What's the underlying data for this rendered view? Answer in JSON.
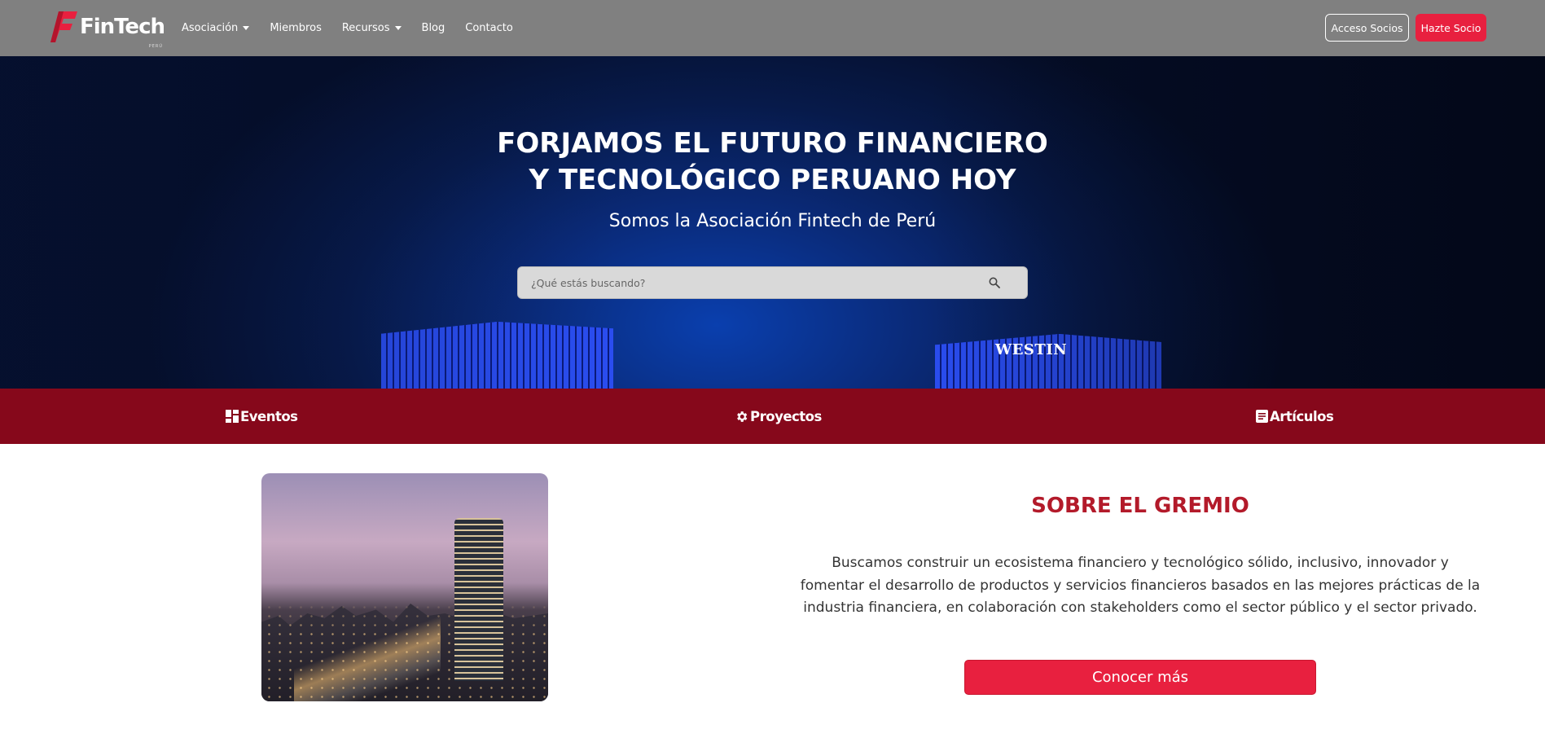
{
  "brand": {
    "name": "FinTech",
    "sub": "PERÚ",
    "color_primary": "#e8203f",
    "color_dark_red": "#86081b"
  },
  "nav": {
    "items": [
      {
        "label": "Asociación",
        "dropdown": true
      },
      {
        "label": "Miembros",
        "dropdown": false
      },
      {
        "label": "Recursos",
        "dropdown": true
      },
      {
        "label": "Blog",
        "dropdown": false
      },
      {
        "label": "Contacto",
        "dropdown": false
      }
    ],
    "acceso_label": "Acceso Socios",
    "hazte_label": "Hazte Socio"
  },
  "hero": {
    "title_line1": "FORJAMOS EL FUTURO FINANCIERO",
    "title_line2": "Y TECNOLÓGICO PERUANO HOY",
    "subtitle": "Somos la Asociación Fintech de Perú",
    "search_placeholder": "¿Qué estás buscando?",
    "sign_text": "WESTIN"
  },
  "categories": [
    {
      "label": "Eventos",
      "icon": "dashboard-icon"
    },
    {
      "label": "Proyectos",
      "icon": "gear-icon"
    },
    {
      "label": "Artículos",
      "icon": "article-icon"
    }
  ],
  "about": {
    "title": "SOBRE EL GREMIO",
    "text": "Buscamos construir un ecosistema financiero y tecnológico sólido, inclusivo, innovador y fomentar el desarrollo de productos y servicios financieros basados en las mejores prácticas de la industria financiera, en colaboración con stakeholders como el sector público y el sector privado.",
    "button_label": "Conocer más"
  }
}
